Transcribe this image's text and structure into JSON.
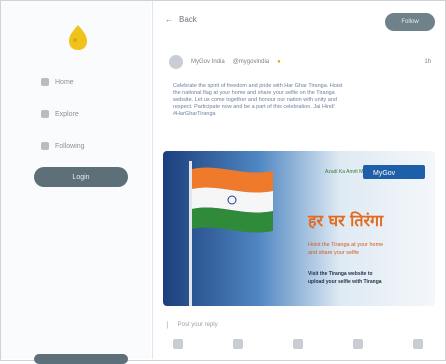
{
  "sidebar": {
    "items": [
      {
        "label": "Home"
      },
      {
        "label": "Explore"
      },
      {
        "label": "Following"
      }
    ],
    "post_button": "Login"
  },
  "topbar": {
    "back_label": "Back",
    "follow_button": "Follow"
  },
  "post": {
    "author": "MyGov India",
    "handle": "@mygovindia",
    "time": "1h",
    "text_lines": [
      "Celebrate the spirit of freedom and pride with Har Ghar Tiranga. Hoist",
      "the national flag at your home and share your selfie on the Tiranga",
      "website. Let us come together and honour our nation with unity and",
      "respect. Participate now and be a part of this celebration. Jai Hind!",
      "#HarGharTiranga"
    ],
    "media": {
      "brand_left": "Azadi Ka Amrit Mahotsav",
      "brand_right": "MyGov",
      "hindi_title": "हर घर तिरंगा",
      "tagline_1": "Hoist the Tiranga at your home",
      "tagline_2": "and share your selfie",
      "cta_1": "Visit the Tiranga website to",
      "cta_2": "upload your selfie with Tiranga"
    },
    "action_placeholder": "Post your reply"
  }
}
